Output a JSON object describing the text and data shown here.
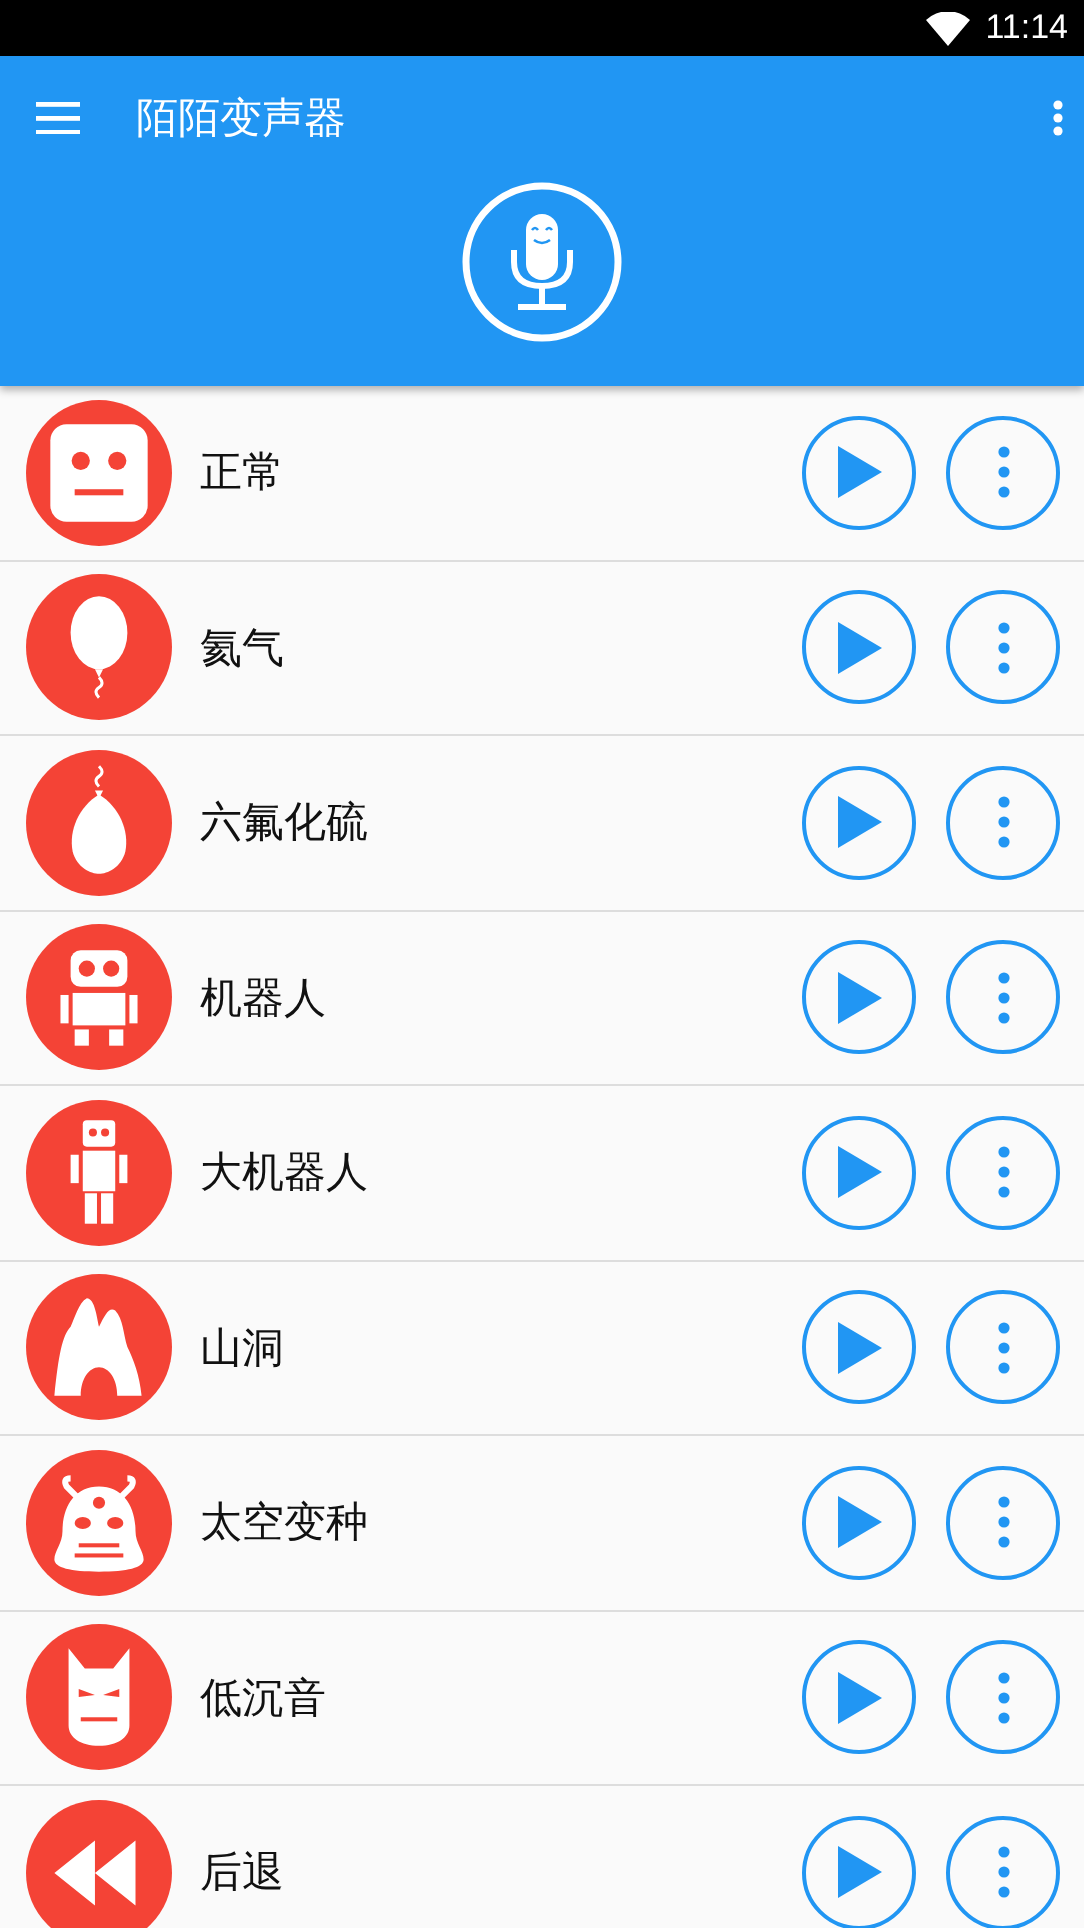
{
  "status_bar": {
    "time": "11:14"
  },
  "app_bar": {
    "title": "陌陌变声器"
  },
  "effects": [
    {
      "name": "正常",
      "kind": "face"
    },
    {
      "name": "氦气",
      "kind": "balloon"
    },
    {
      "name": "六氟化硫",
      "kind": "heavy-balloon"
    },
    {
      "name": "机器人",
      "kind": "robot"
    },
    {
      "name": "大机器人",
      "kind": "tall-robot"
    },
    {
      "name": "山洞",
      "kind": "cave"
    },
    {
      "name": "太空变种",
      "kind": "alien"
    },
    {
      "name": "低沉音",
      "kind": "mask"
    },
    {
      "name": "后退",
      "kind": "rewind"
    }
  ]
}
